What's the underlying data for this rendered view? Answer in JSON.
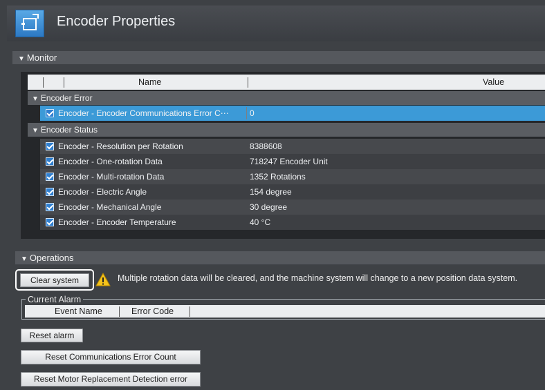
{
  "title": "Encoder Properties",
  "monitor": {
    "header": "Monitor",
    "columns": {
      "name": "Name",
      "value": "Value"
    },
    "groups": [
      {
        "label": "Encoder Error",
        "rows": [
          {
            "name": "Encoder - Encoder Communications Error C⋯",
            "value": "0",
            "checked": true,
            "selected": true
          }
        ]
      },
      {
        "label": "Encoder Status",
        "rows": [
          {
            "name": "Encoder - Resolution per Rotation",
            "value": "8388608",
            "checked": true
          },
          {
            "name": "Encoder - One-rotation Data",
            "value": "718247 Encoder Unit",
            "checked": true
          },
          {
            "name": "Encoder - Multi-rotation Data",
            "value": "1352 Rotations",
            "checked": true
          },
          {
            "name": "Encoder - Electric Angle",
            "value": "154 degree",
            "checked": true
          },
          {
            "name": "Encoder - Mechanical Angle",
            "value": "30 degree",
            "checked": true
          },
          {
            "name": "Encoder - Encoder Temperature",
            "value": "40 °C",
            "checked": true
          }
        ]
      }
    ]
  },
  "operations": {
    "header": "Operations",
    "clear_system_label": "Clear system",
    "warning_text": "Multiple rotation data will be cleared, and the machine system will change to a new position data system.",
    "warning_icon": "warning-triangle-icon",
    "current_alarm": {
      "label": "Current Alarm",
      "columns": {
        "event_name": "Event Name",
        "error_code": "Error Code"
      }
    },
    "reset_alarm_label": "Reset alarm",
    "reset_comm_error_label": "Reset Communications Error Count",
    "reset_motor_label": "Reset Motor Replacement Detection error"
  },
  "colors": {
    "accent": "#3c9ad7",
    "checkbox": "#2f7fd0",
    "background": "#3e4145",
    "warning": "#f4c21b"
  }
}
